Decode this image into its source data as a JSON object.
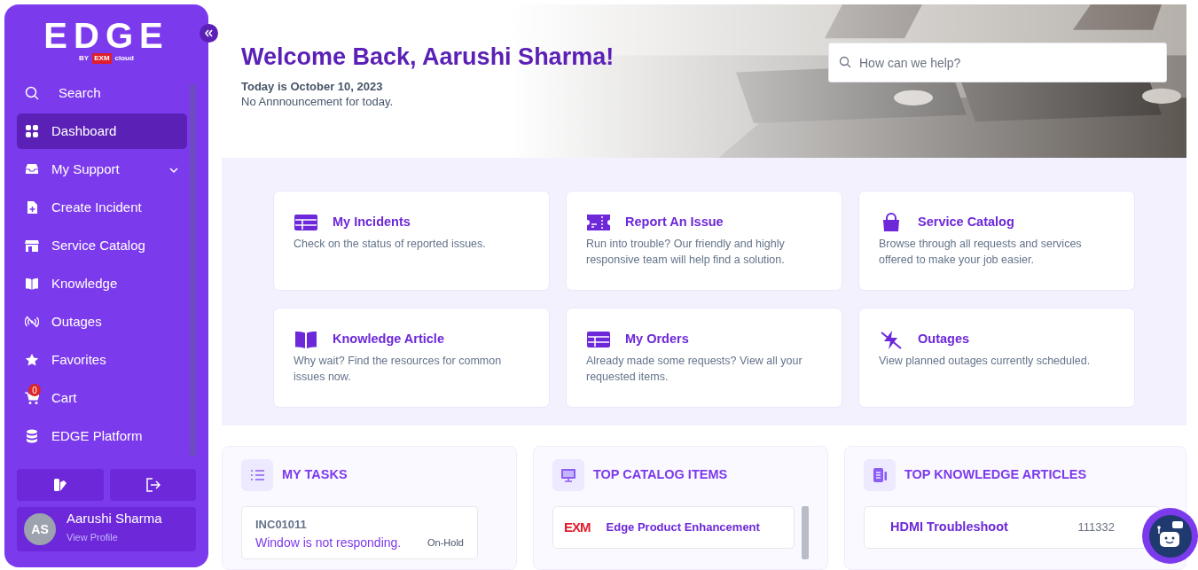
{
  "sidebar": {
    "logo": {
      "wordmark": "EDGE",
      "by": "BY",
      "brand": "EXM",
      "brand_suffix": "cloud"
    },
    "items": [
      {
        "label": "Search",
        "selected": false
      },
      {
        "label": "Dashboard",
        "selected": true
      },
      {
        "label": "My Support",
        "selected": false,
        "expanded": false
      },
      {
        "label": "Create Incident",
        "selected": false
      },
      {
        "label": "Service Catalog",
        "selected": false
      },
      {
        "label": "Knowledge",
        "selected": false
      },
      {
        "label": "Outages",
        "selected": false
      },
      {
        "label": "Favorites",
        "selected": false
      },
      {
        "label": "Cart",
        "selected": false,
        "badge": "0"
      },
      {
        "label": "EDGE Platform",
        "selected": false
      }
    ],
    "profile": {
      "initials": "AS",
      "name": "Aarushi Sharma",
      "link": "View Profile"
    }
  },
  "hero": {
    "title": "Welcome Back, Aarushi Sharma!",
    "date": "Today is October 10, 2023",
    "announcement": "No Annnouncement for today.",
    "search": {
      "placeholder": "How can we help?"
    }
  },
  "cards": [
    {
      "title": "My Incidents",
      "description": "Check on the status of reported issues."
    },
    {
      "title": "Report An Issue",
      "description": "Run into trouble? Our friendly and highly responsive team will help find a solution."
    },
    {
      "title": "Service Catalog",
      "description": "Browse through all requests and services offered to make your job easier."
    },
    {
      "title": "Knowledge Article",
      "description": "Why wait? Find the resources for common issues now."
    },
    {
      "title": "My Orders",
      "description": "Already made some requests? View all your requested items."
    },
    {
      "title": "Outages",
      "description": "View planned outages currently scheduled."
    }
  ],
  "panels": [
    {
      "title": "MY TASKS",
      "kind": "task",
      "items": [
        {
          "number": "INC01011",
          "summary": "Window is not responding.",
          "status": "On-Hold"
        }
      ]
    },
    {
      "title": "TOP CATALOG ITEMS",
      "kind": "catalog",
      "items": [
        {
          "logo": "EXM",
          "name": "Edge Product Enhancement"
        }
      ]
    },
    {
      "title": "TOP KNOWLEDGE ARTICLES",
      "kind": "article",
      "items": [
        {
          "title": "HDMI Troubleshoot",
          "number": "111332"
        }
      ]
    }
  ]
}
